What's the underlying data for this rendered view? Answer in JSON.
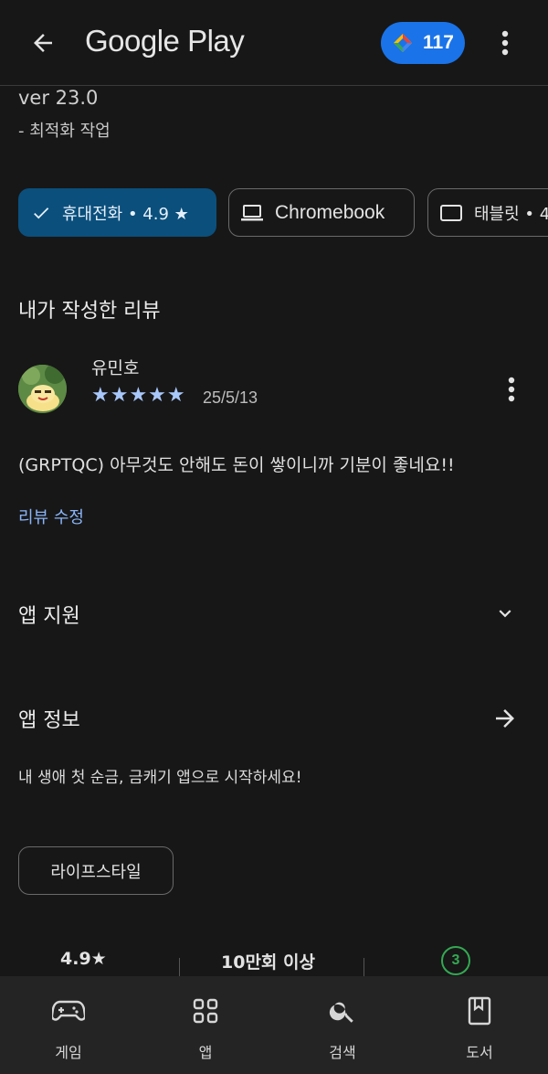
{
  "header": {
    "app_title": "Google Play",
    "points": "117"
  },
  "version": {
    "label": "ver 23.0",
    "note": "- 최적화 작업"
  },
  "device_chips": [
    {
      "label": "휴대전화 • 4.9 ★",
      "selected": true
    },
    {
      "label": "Chromebook",
      "selected": false
    },
    {
      "label": "태블릿 • 4",
      "selected": false
    }
  ],
  "my_review": {
    "title": "내가 작성한 리뷰",
    "reviewer": "유민호",
    "stars": "★★★★★",
    "date": "25/5/13",
    "text": "(GRPTQC) 아무것도 안해도 돈이 쌓이니까 기분이 좋네요!!",
    "edit_label": "리뷰 수정"
  },
  "app_support": {
    "title": "앱 지원"
  },
  "app_info": {
    "title": "앱 정보",
    "description": "내 생애 첫 순금, 금캐기 앱으로 시작하세요!",
    "tag": "라이프스타일"
  },
  "stats": {
    "rating": "4.9★",
    "downloads": "10만회 이상",
    "age_rating": "3"
  },
  "bottom_nav": [
    {
      "label": "게임",
      "icon": "gamepad-icon"
    },
    {
      "label": "앱",
      "icon": "apps-grid-icon"
    },
    {
      "label": "검색",
      "icon": "search-icon"
    },
    {
      "label": "도서",
      "icon": "book-icon"
    }
  ],
  "colors": {
    "accent": "#1a73e8",
    "chip_selected": "#0b4f7c",
    "star": "#a8c7fa",
    "link": "#8ab4f8",
    "age_badge": "#34a853",
    "background": "#171717"
  }
}
